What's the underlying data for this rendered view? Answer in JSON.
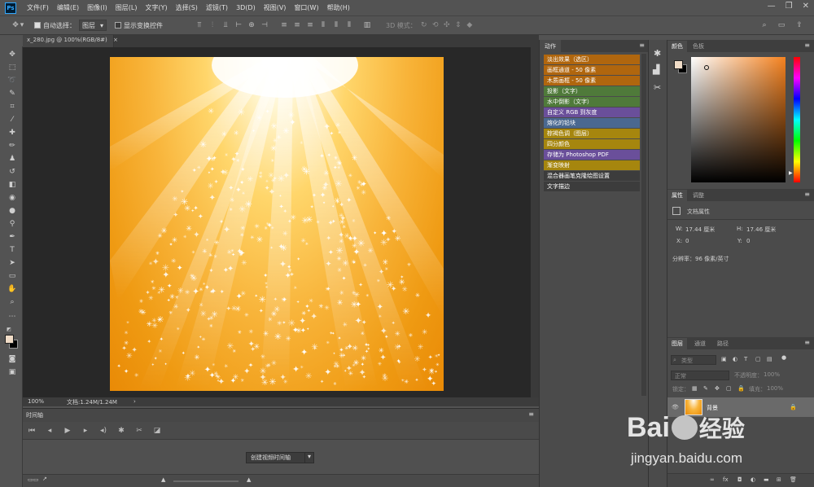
{
  "app": {
    "logo": "Ps"
  },
  "menu": [
    "文件(F)",
    "编辑(E)",
    "图像(I)",
    "图层(L)",
    "文字(Y)",
    "选择(S)",
    "滤镜(T)",
    "3D(D)",
    "视图(V)",
    "窗口(W)",
    "帮助(H)"
  ],
  "options": {
    "auto_select_label": "自动选择：",
    "auto_select_value": "图层",
    "show_transform_label": "显示变换控件",
    "mode_3d_label": "3D 模式："
  },
  "document": {
    "tab_title": "x_280.jpg @ 100%(RGB/8#)",
    "zoom": "100%",
    "doc_size": "文档:1.24M/1.24M"
  },
  "timeline": {
    "title": "时间轴",
    "create_button": "创建视频时间轴"
  },
  "actions_panel": {
    "title": "动作",
    "items": [
      {
        "label": "淡出效果（选区）",
        "color": "#b0660e"
      },
      {
        "label": "画框通道 - 50 像素",
        "color": "#b0660e"
      },
      {
        "label": "木质画框 - 50 像素",
        "color": "#b0660e"
      },
      {
        "label": "投影（文字）",
        "color": "#4f7a3a"
      },
      {
        "label": "水中倒影（文字）",
        "color": "#4f7a3a"
      },
      {
        "label": "自定义 RGB 到灰度",
        "color": "#6a4f9a"
      },
      {
        "label": "熔化的铅块",
        "color": "#4a6890"
      },
      {
        "label": "棕褐色调（图层）",
        "color": "#a6860e"
      },
      {
        "label": "四分颜色",
        "color": "#a6860e"
      },
      {
        "label": "存储为 Photoshop PDF",
        "color": "#6a4f9a"
      },
      {
        "label": "渐变映射",
        "color": "#a6860e"
      },
      {
        "label": "混合器画笔克隆绘图设置",
        "color": "#3c3c3c"
      },
      {
        "label": "文字描边",
        "color": "#3c3c3c"
      }
    ]
  },
  "color_panel": {
    "tabs": [
      "颜色",
      "色板"
    ],
    "foreground": "#f0dcc7",
    "background": "#000000",
    "hue_color": "#f5821f"
  },
  "properties_panel": {
    "tabs": [
      "属性",
      "调整"
    ],
    "heading": "文档属性",
    "w_label": "W:",
    "w_value": "17.44 厘米",
    "h_label": "H:",
    "h_value": "17.46 厘米",
    "x_label": "X:",
    "x_value": "0",
    "y_label": "Y:",
    "y_value": "0",
    "resolution": "分辨率：96 像素/英寸"
  },
  "layers_panel": {
    "tabs": [
      "图层",
      "通道",
      "路径"
    ],
    "filter_label": "类型",
    "blend_mode": "正常",
    "opacity_label": "不透明度：",
    "opacity_value": "100%",
    "lock_label": "锁定：",
    "fill_label": "填充：",
    "fill_value": "100%",
    "layer_name": "背景"
  },
  "watermark": {
    "brand": "Bai",
    "brand2": "经验",
    "url": "jingyan.baidu.com"
  }
}
